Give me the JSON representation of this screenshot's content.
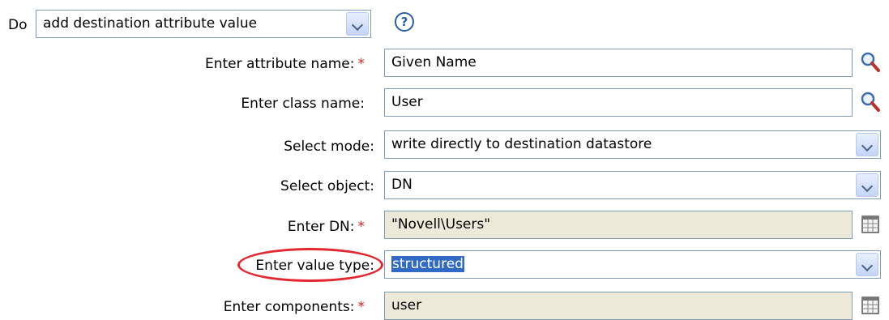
{
  "action": {
    "do_label": "Do",
    "selected": "add destination attribute value",
    "help_glyph": "?"
  },
  "fields": {
    "attribute_name": {
      "label": "Enter attribute name:",
      "required": "*",
      "value": "Given Name"
    },
    "class_name": {
      "label": "Enter class name:",
      "value": "User"
    },
    "mode": {
      "label": "Select mode:",
      "value": "write directly to destination datastore"
    },
    "object": {
      "label": "Select object:",
      "value": "DN"
    },
    "dn": {
      "label": "Enter DN:",
      "required": "*",
      "value": "\"Novell\\Users\""
    },
    "value_type": {
      "label": "Enter value type:",
      "value": "structured"
    },
    "components": {
      "label": "Enter components:",
      "required": "*",
      "value": "user"
    }
  },
  "colors": {
    "required_marker": "#e0201c",
    "annotation_ellipse": "#e32630",
    "selection_highlight": "#316ac5",
    "readonly_field_bg": "#ece9d8"
  },
  "icons": [
    "chevron-down-icon",
    "help-icon",
    "search-icon",
    "table-icon"
  ]
}
